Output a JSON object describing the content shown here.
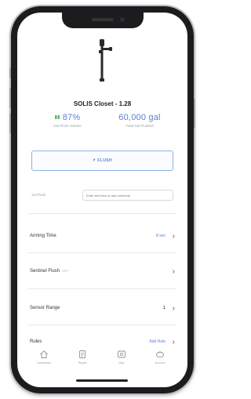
{
  "device": {
    "name": "SOLIS Closet - 1.28"
  },
  "stats": {
    "battery_badge": "▮▮",
    "battery_value": "87%",
    "battery_caption": "last Flush Volume",
    "gallons_value": "60,000 gal",
    "gallons_caption": "Total Gal Flushed"
  },
  "flush_button": {
    "label": "↱ FLUSH"
  },
  "note": {
    "label": "1st Flush",
    "placeholder": "Enter text here to add comment"
  },
  "settings": {
    "rows": [
      {
        "label": "Arming Time",
        "sub": "",
        "value": "8 sec"
      },
      {
        "label": "Sentinel Flush",
        "sub": "OFF",
        "value": ""
      },
      {
        "label": "Sensor Range",
        "sub": "",
        "value": "1"
      },
      {
        "label": "Rules",
        "sub": "",
        "value": "Add Rule"
      }
    ]
  },
  "tabs": [
    {
      "label": "Dashboard",
      "icon": "home-icon"
    },
    {
      "label": "Report",
      "icon": "document-icon"
    },
    {
      "label": "Map",
      "icon": "map-icon"
    },
    {
      "label": "Account",
      "icon": "account-icon"
    }
  ],
  "colors": {
    "accent": "#5a7fd6",
    "battery": "#5cb85c",
    "frame": "#1c1c1e"
  }
}
